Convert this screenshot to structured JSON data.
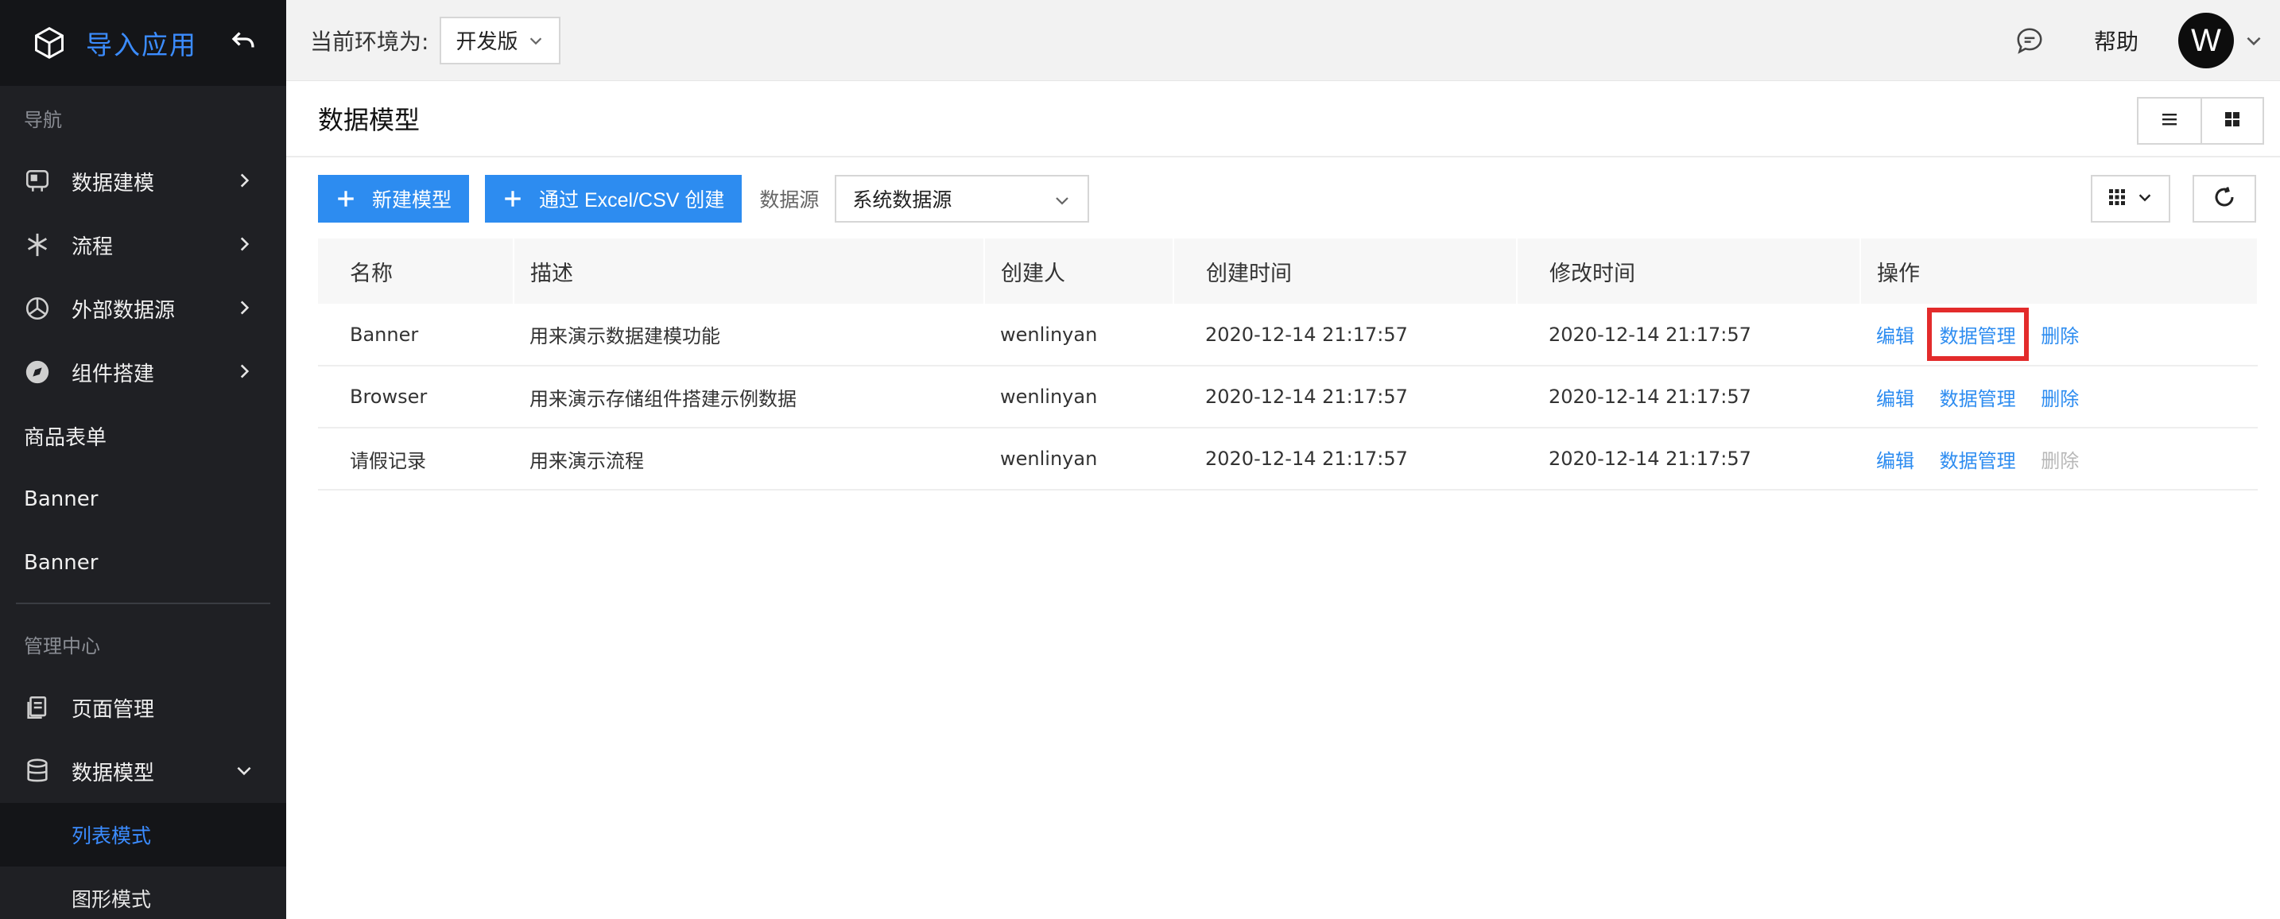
{
  "sidebar": {
    "brand_title": "导入应用",
    "nav_section": "导航",
    "nav_items": [
      {
        "label": "数据建模",
        "icon": "data-modeling-icon"
      },
      {
        "label": "流程",
        "icon": "flow-icon"
      },
      {
        "label": "外部数据源",
        "icon": "external-datasource-icon"
      },
      {
        "label": "组件搭建",
        "icon": "component-icon"
      }
    ],
    "plain_items": [
      "商品表单",
      "Banner",
      "Banner"
    ],
    "manage_section": "管理中心",
    "manage_items": [
      {
        "label": "页面管理",
        "icon": "page-icon"
      },
      {
        "label": "数据模型",
        "icon": "database-icon"
      }
    ],
    "sub_items": [
      "列表模式",
      "图形模式"
    ]
  },
  "topbar": {
    "env_label": "当前环境为:",
    "env_value": "开发版",
    "help": "帮助",
    "avatar_letter": "W"
  },
  "page": {
    "title": "数据模型"
  },
  "toolbar": {
    "new_model": "新建模型",
    "import_excel": "通过 Excel/CSV 创建",
    "datasource_label": "数据源",
    "datasource_value": "系统数据源"
  },
  "table": {
    "headers": [
      "名称",
      "描述",
      "创建人",
      "创建时间",
      "修改时间",
      "操作"
    ],
    "rows": [
      {
        "name": "Banner",
        "desc": "用来演示数据建模功能",
        "creator": "wenlinyan",
        "created": "2020-12-14 21:17:57",
        "modified": "2020-12-14 21:17:57"
      },
      {
        "name": "Browser",
        "desc": "用来演示存储组件搭建示例数据",
        "creator": "wenlinyan",
        "created": "2020-12-14 21:17:57",
        "modified": "2020-12-14 21:17:57"
      },
      {
        "name": "请假记录",
        "desc": "用来演示流程",
        "creator": "wenlinyan",
        "created": "2020-12-14 21:17:57",
        "modified": "2020-12-14 21:17:57"
      }
    ],
    "actions": {
      "edit": "编辑",
      "manage": "数据管理",
      "delete": "删除"
    }
  },
  "colors": {
    "accent": "#2d8cf0",
    "sidebar_bg": "#1f2024",
    "highlight_box": "#e32b2b",
    "disabled": "#b8b8b8"
  }
}
